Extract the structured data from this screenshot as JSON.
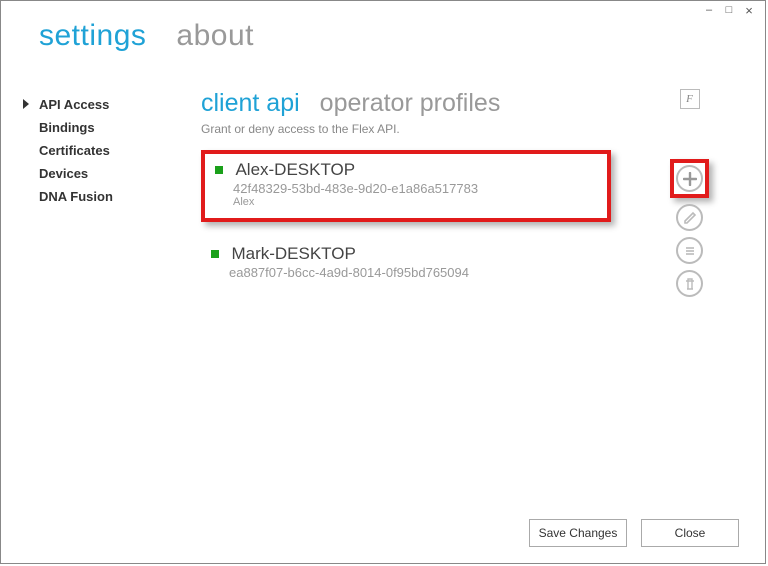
{
  "window_controls": {
    "min": "–",
    "max": "□",
    "close": "×"
  },
  "tabs": [
    {
      "label": "settings",
      "active": true
    },
    {
      "label": "about",
      "active": false
    }
  ],
  "sidebar": {
    "items": [
      {
        "label": "API Access",
        "selected": true
      },
      {
        "label": "Bindings",
        "selected": false
      },
      {
        "label": "Certificates",
        "selected": false
      },
      {
        "label": "Devices",
        "selected": false
      },
      {
        "label": "DNA Fusion",
        "selected": false
      }
    ]
  },
  "section": {
    "heads": [
      {
        "label": "client api",
        "active": true
      },
      {
        "label": "operator profiles",
        "active": false
      }
    ],
    "subtitle": "Grant or deny access to the Flex API."
  },
  "colors": {
    "accent": "#1fa2d6",
    "highlight_border": "#e11b1b",
    "status_dot": "#1aa01a"
  },
  "clients": [
    {
      "name": "Alex-DESKTOP",
      "guid": "42f48329-53bd-483e-9d20-e1a86a517783",
      "owner": "Alex",
      "status_color": "#1aa01a",
      "highlighted": true
    },
    {
      "name": "Mark-DESKTOP",
      "guid": "ea887f07-b6cc-4a9d-8014-0f95bd765094",
      "owner": "",
      "status_color": "#1aa01a",
      "highlighted": false
    }
  ],
  "icon_column": {
    "filter_label": "F",
    "buttons": [
      {
        "name": "add-icon",
        "highlighted": true
      },
      {
        "name": "edit-icon",
        "highlighted": false
      },
      {
        "name": "list-icon",
        "highlighted": false
      },
      {
        "name": "delete-icon",
        "highlighted": false
      }
    ]
  },
  "footer": {
    "save_label": "Save Changes",
    "close_label": "Close"
  }
}
